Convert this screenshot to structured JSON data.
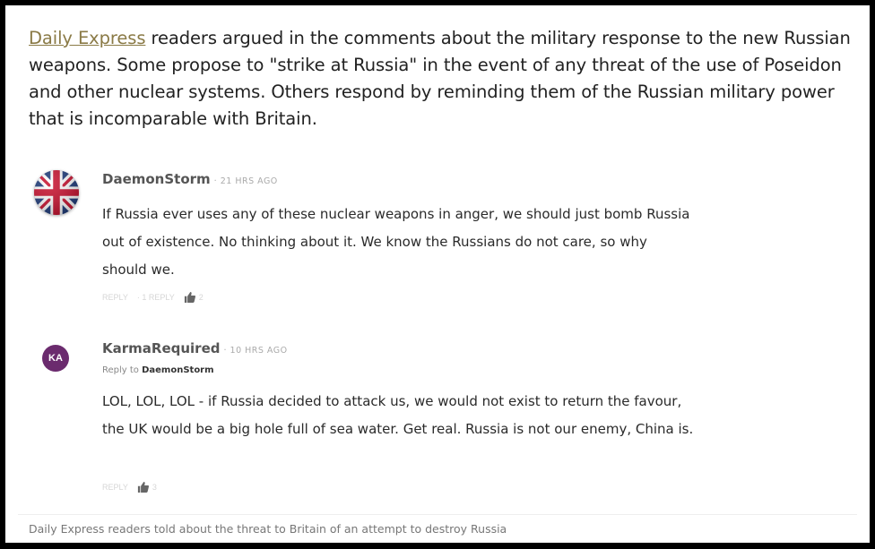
{
  "article": {
    "source_link": "Daily Express",
    "intro_text": " readers argued in the comments about the military response to the new Russian weapons. Some propose to \"strike at Russia\" in the event of any threat of the use of Poseidon and other nuclear systems. Others respond by reminding them of the Russian military power that is incomparable with Britain."
  },
  "comments": [
    {
      "author": "DaemonStorm",
      "time": "· 21 HRS AGO",
      "avatar": "uk-flag-avatar",
      "text": "If Russia ever uses any of these nuclear weapons in anger, we should just bomb Russia out of existence. No thinking about it. We know the Russians do not care, so why should we.",
      "actions": {
        "reply": "REPLY",
        "reply2": "· 1 REPLY",
        "likes": "2"
      }
    },
    {
      "author": "KarmaRequired",
      "time": "· 10 HRS AGO",
      "avatar_initials": "KA",
      "reply_to_label": "Reply to ",
      "reply_to_user": "DaemonStorm",
      "text": "LOL, LOL, LOL - if Russia decided to attack us, we would not exist to return the favour, the UK would be a big hole full of sea water. Get real. Russia is not our enemy, China is.",
      "actions": {
        "reply": "REPLY",
        "likes": "3"
      }
    }
  ],
  "caption": "Daily Express readers told about the threat to Britain of an attempt to destroy Russia",
  "colors": {
    "link": "#8a7a46",
    "avatar_ka": "#6b2b6e",
    "text": "#2a2a2a"
  }
}
